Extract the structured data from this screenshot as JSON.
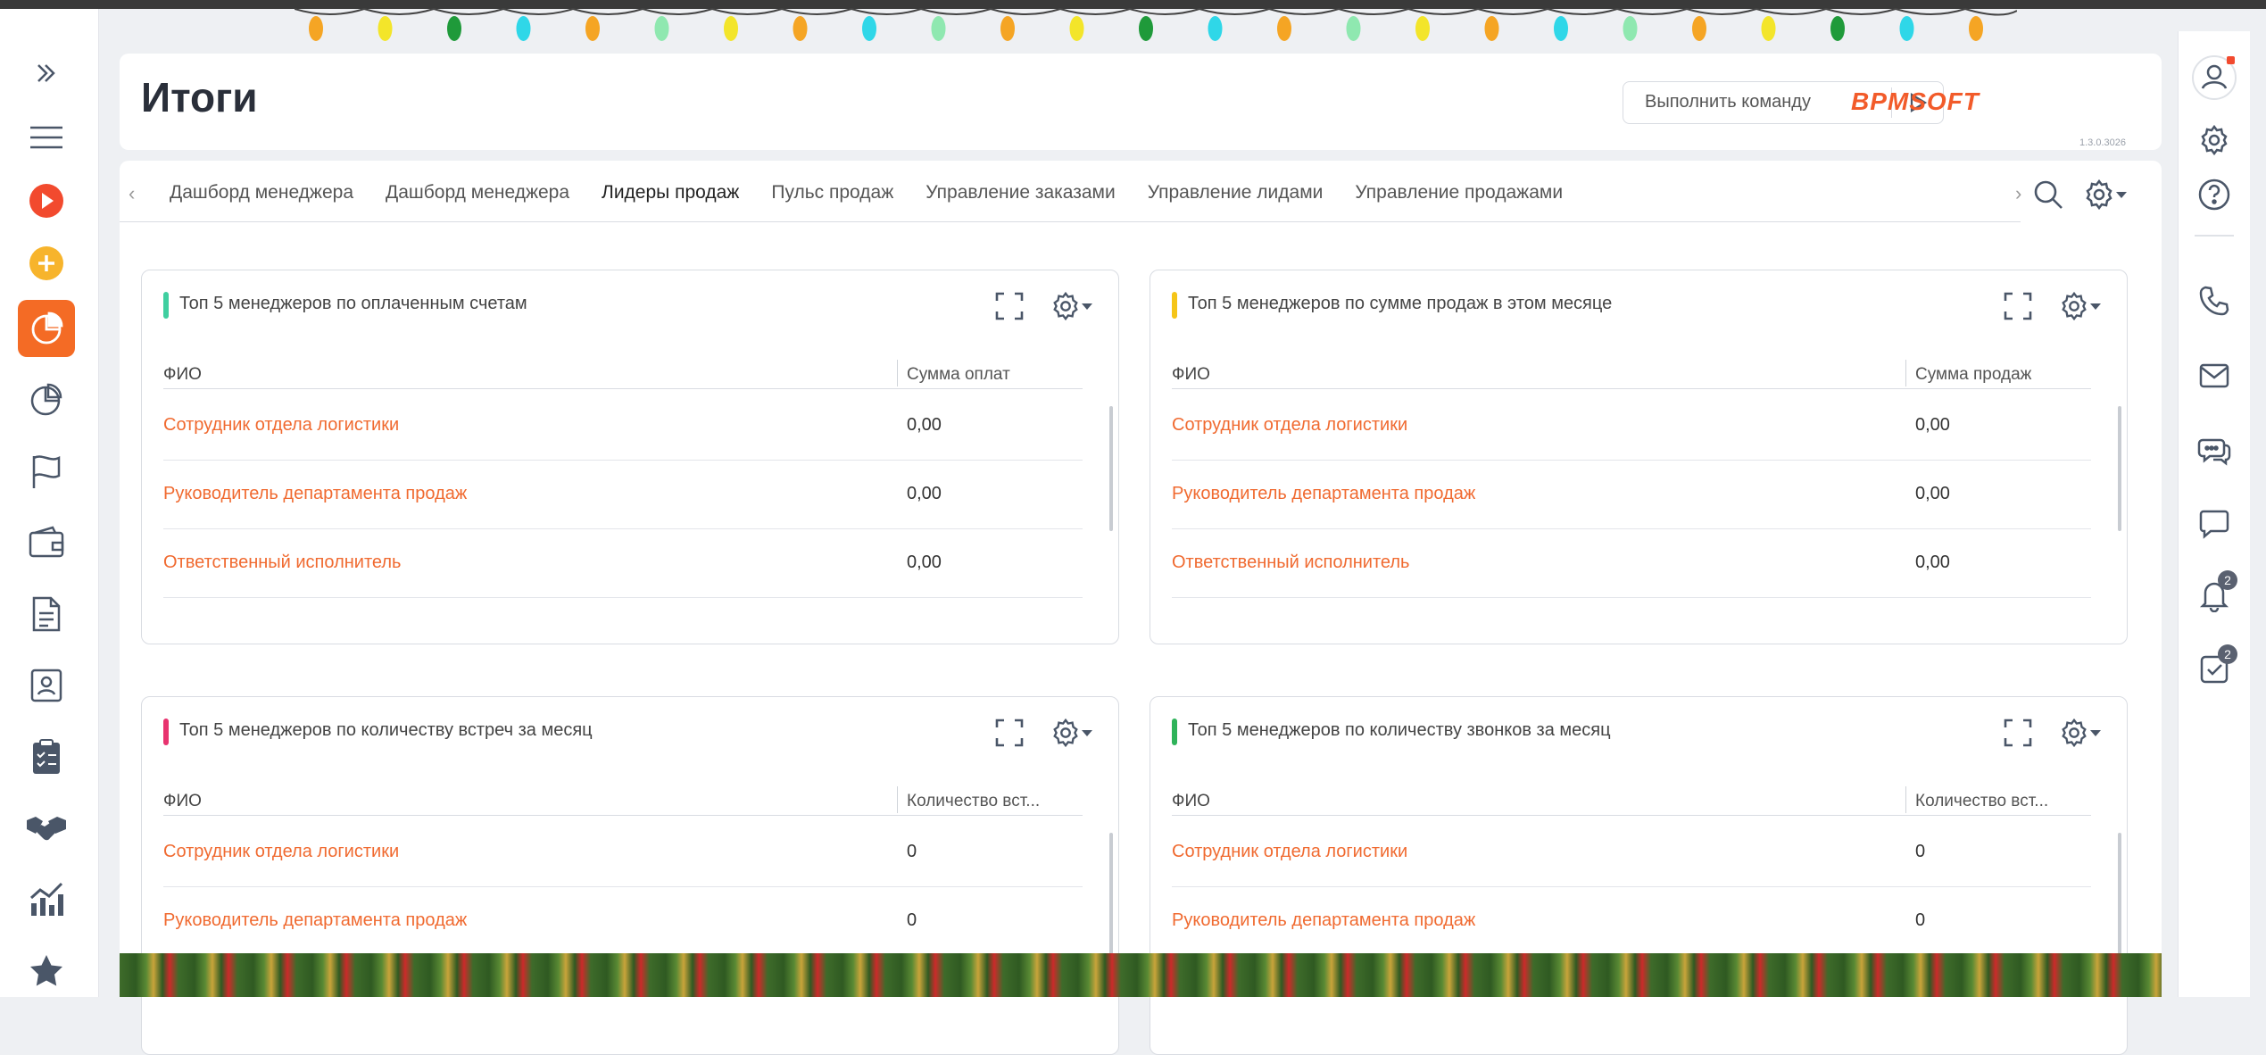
{
  "header": {
    "title": "Итоги",
    "command_placeholder": "Выполнить команду",
    "logo_text": "BPMSOFT",
    "version": "1.3.0.3026"
  },
  "left_sidebar": {
    "items": [
      {
        "icon": "chevrons-right-icon"
      },
      {
        "icon": "menu-icon"
      },
      {
        "icon": "play-icon"
      },
      {
        "icon": "plus-circle-icon"
      },
      {
        "icon": "pie-chart-icon",
        "active": true
      },
      {
        "icon": "pie-chart-outline-icon"
      },
      {
        "icon": "flag-icon"
      },
      {
        "icon": "wallet-icon"
      },
      {
        "icon": "document-icon"
      },
      {
        "icon": "contact-card-icon"
      },
      {
        "icon": "clipboard-icon"
      },
      {
        "icon": "handshake-icon"
      },
      {
        "icon": "analytics-icon"
      },
      {
        "icon": "star-icon"
      }
    ]
  },
  "right_sidebar": {
    "notifications_badge": "2",
    "tasks_badge": "2"
  },
  "tabs": [
    {
      "label": "Дашборд менеджера"
    },
    {
      "label": "Дашборд менеджера"
    },
    {
      "label": "Лидеры продаж",
      "active": true
    },
    {
      "label": "Пульс продаж"
    },
    {
      "label": "Управление заказами"
    },
    {
      "label": "Управление лидами"
    },
    {
      "label": "Управление продажами"
    }
  ],
  "widgets": [
    {
      "title": "Топ 5 менеджеров по оплаченным счетам",
      "accent": "#3fcfa0",
      "col1": "ФИО",
      "col2": "Сумма оплат",
      "rows": [
        {
          "name": "Сотрудник отдела логистики",
          "value": "0,00"
        },
        {
          "name": "Руководитель департамента продаж",
          "value": "0,00"
        },
        {
          "name": "Ответственный исполнитель",
          "value": "0,00"
        }
      ]
    },
    {
      "title": "Топ 5 менеджеров по сумме продаж в этом месяце",
      "accent": "#f5c518",
      "col1": "ФИО",
      "col2": "Сумма продаж",
      "rows": [
        {
          "name": "Сотрудник отдела логистики",
          "value": "0,00"
        },
        {
          "name": "Руководитель департамента продаж",
          "value": "0,00"
        },
        {
          "name": "Ответственный исполнитель",
          "value": "0,00"
        }
      ]
    },
    {
      "title": "Топ 5 менеджеров по количеству встреч за месяц",
      "accent": "#e8336f",
      "col1": "ФИО",
      "col2": "Количество вст...",
      "rows": [
        {
          "name": "Сотрудник отдела логистики",
          "value": "0"
        },
        {
          "name": "Руководитель департамента продаж",
          "value": "0"
        }
      ]
    },
    {
      "title": "Топ 5 менеджеров по количеству звонков за месяц",
      "accent": "#2fb35a",
      "col1": "ФИО",
      "col2": "Количество вст...",
      "rows": [
        {
          "name": "Сотрудник отдела логистики",
          "value": "0"
        },
        {
          "name": "Руководитель департамента продаж",
          "value": "0"
        }
      ]
    }
  ],
  "colors": {
    "brand": "#f46b25",
    "link": "#f06a30"
  }
}
